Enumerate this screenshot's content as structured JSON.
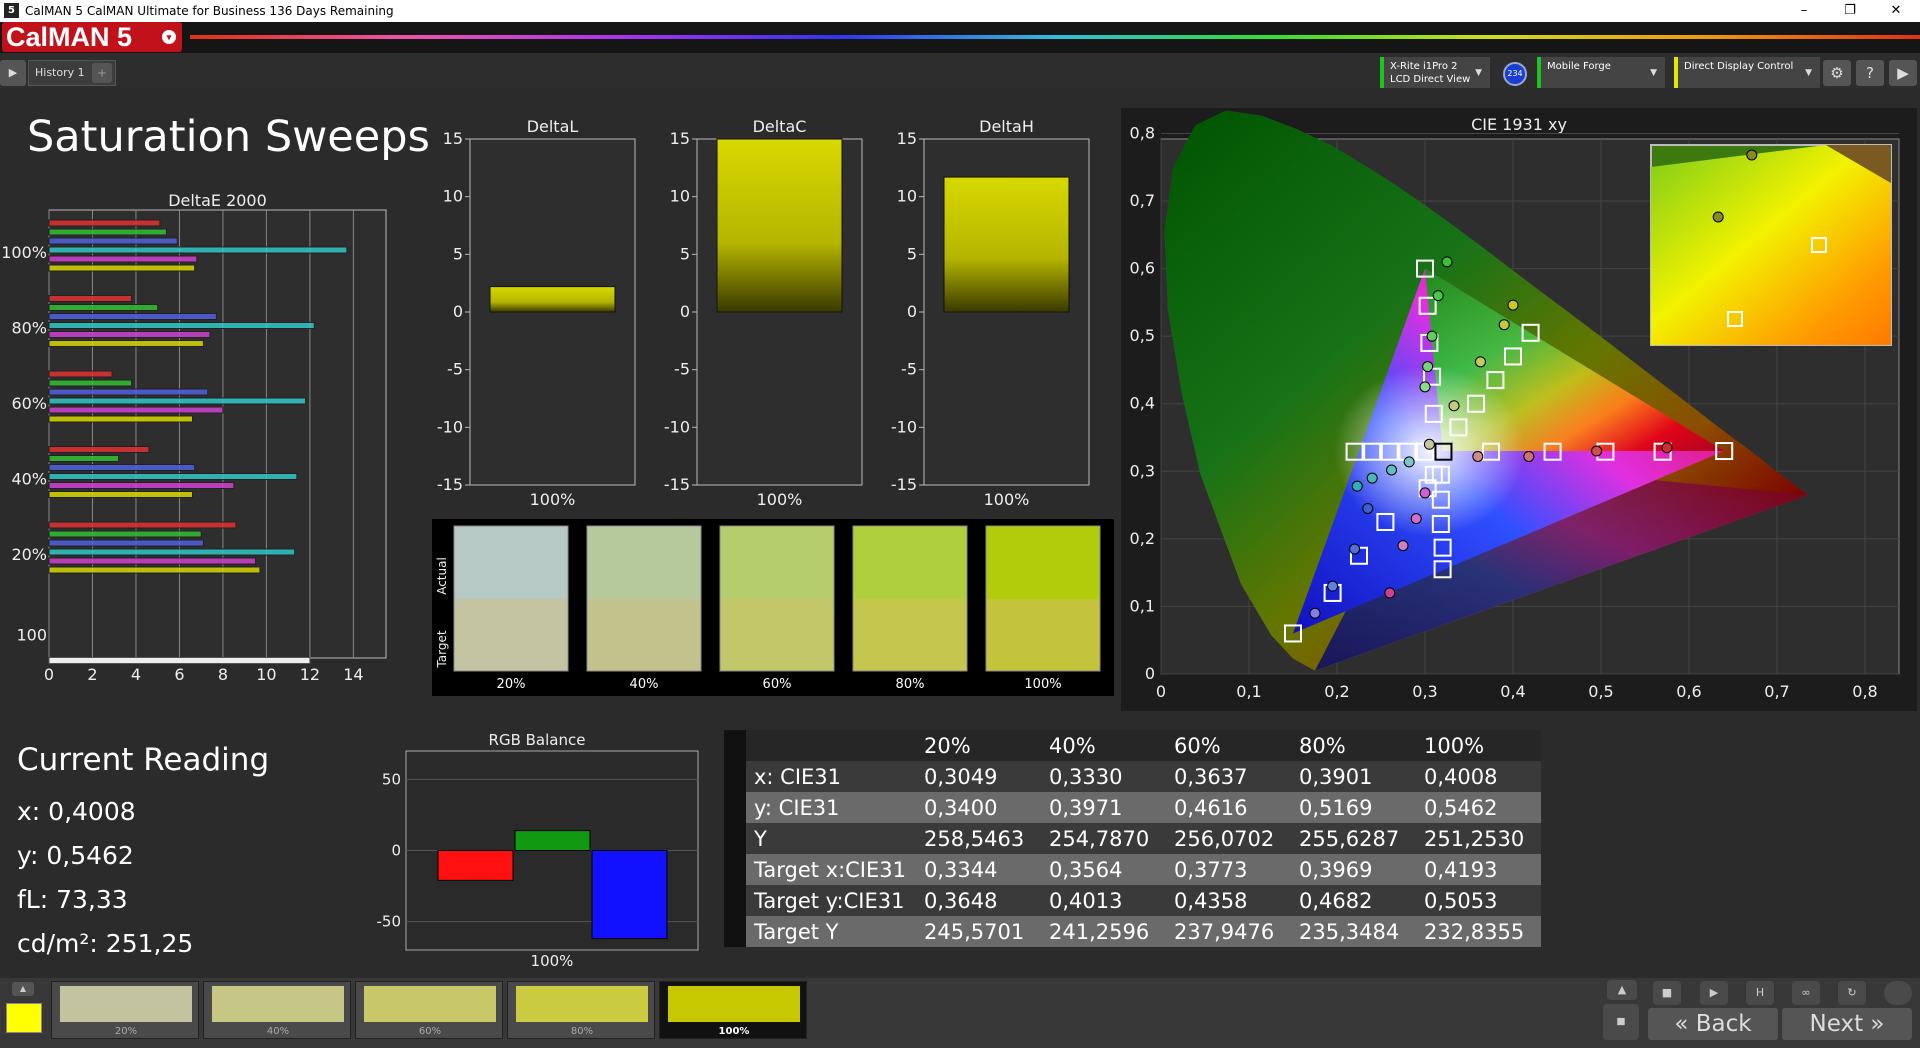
{
  "window": {
    "title": "CalMAN 5 CalMAN Ultimate for Business 136 Days Remaining",
    "minimize": "–",
    "maximize": "❐",
    "close": "✕"
  },
  "brand": {
    "name": "CalMAN 5",
    "menu": "▾"
  },
  "tabs": [
    {
      "label": "History 1"
    }
  ],
  "tab_add": "+",
  "devices": [
    {
      "line1": "X-Rite i1Pro 2",
      "line2": "LCD Direct View",
      "accent": "#1fc41f"
    },
    {
      "line1": "Mobile Forge",
      "line2": "",
      "accent": "#1fc41f"
    },
    {
      "line1": "Direct Display Control",
      "line2": "",
      "accent": "#e6e600"
    }
  ],
  "device_badge": "234",
  "toolbar_icons": [
    "gear-icon",
    "help-icon",
    "chevron-right-icon"
  ],
  "page_title": "Saturation Sweeps",
  "colors": {
    "accent": "#c8c800",
    "brand_red": "#c1121c"
  },
  "deltae": {
    "title": "DeltaE 2000",
    "ytick_labels": [
      "100%",
      "80%",
      "60%",
      "40%",
      "20%",
      "100"
    ],
    "xticks": [
      0,
      2,
      4,
      6,
      8,
      10,
      12,
      14
    ],
    "groups": [
      {
        "label": "100%",
        "values": [
          5.1,
          5.4,
          5.9,
          13.7,
          6.8,
          6.7
        ]
      },
      {
        "label": "80%",
        "values": [
          3.8,
          5.0,
          7.7,
          12.2,
          7.4,
          7.1
        ]
      },
      {
        "label": "60%",
        "values": [
          2.9,
          3.8,
          7.3,
          11.8,
          8.0,
          6.6
        ]
      },
      {
        "label": "40%",
        "values": [
          4.6,
          3.2,
          6.7,
          11.4,
          8.5,
          6.6
        ]
      },
      {
        "label": "20%",
        "values": [
          8.6,
          7.0,
          7.1,
          11.3,
          9.5,
          9.7
        ]
      },
      {
        "label": "100",
        "values": [
          12.0
        ]
      }
    ],
    "series_colors": [
      "#e03030",
      "#30c030",
      "#5060e0",
      "#30c8c8",
      "#d040d0",
      "#d8d800"
    ]
  },
  "delta_charts": [
    {
      "title": "DeltaL",
      "value": 2.2,
      "category": "100%"
    },
    {
      "title": "DeltaC",
      "value": 15.0,
      "category": "100%"
    },
    {
      "title": "DeltaH",
      "value": 11.7,
      "category": "100%"
    }
  ],
  "delta_yticks": [
    15,
    10,
    5,
    0,
    -5,
    -10,
    -15
  ],
  "swatches": {
    "actual_label": "Actual",
    "target_label": "Target",
    "items": [
      {
        "label": "20%",
        "actual": "#b7c9c4",
        "target": "#c4c4a2"
      },
      {
        "label": "40%",
        "actual": "#b6c99d",
        "target": "#c2c28c"
      },
      {
        "label": "60%",
        "actual": "#b6cd6d",
        "target": "#c4c66a"
      },
      {
        "label": "80%",
        "actual": "#b0cf3c",
        "target": "#c4c64e"
      },
      {
        "label": "100%",
        "actual": "#b0cc0a",
        "target": "#c4c43c"
      }
    ]
  },
  "cie": {
    "title": "CIE 1931 xy",
    "xticks": [
      "0",
      "0,1",
      "0,2",
      "0,3",
      "0,4",
      "0,5",
      "0,6",
      "0,7",
      "0,8"
    ],
    "yticks": [
      "0",
      "0,1",
      "0,2",
      "0,3",
      "0,4",
      "0,5",
      "0,6",
      "0,7",
      "0,8"
    ],
    "targets": [
      [
        0.3,
        0.6
      ],
      [
        0.303,
        0.545
      ],
      [
        0.305,
        0.49
      ],
      [
        0.308,
        0.44
      ],
      [
        0.31,
        0.385
      ],
      [
        0.321,
        0.329
      ],
      [
        0.375,
        0.329
      ],
      [
        0.445,
        0.329
      ],
      [
        0.505,
        0.329
      ],
      [
        0.57,
        0.329
      ],
      [
        0.64,
        0.33
      ],
      [
        0.42,
        0.505
      ],
      [
        0.4,
        0.47
      ],
      [
        0.38,
        0.435
      ],
      [
        0.358,
        0.4
      ],
      [
        0.338,
        0.365
      ],
      [
        0.22,
        0.329
      ],
      [
        0.24,
        0.329
      ],
      [
        0.26,
        0.329
      ],
      [
        0.28,
        0.329
      ],
      [
        0.3,
        0.329
      ],
      [
        0.31,
        0.295
      ],
      [
        0.303,
        0.275
      ],
      [
        0.255,
        0.225
      ],
      [
        0.225,
        0.175
      ],
      [
        0.195,
        0.12
      ],
      [
        0.15,
        0.06
      ],
      [
        0.318,
        0.295
      ],
      [
        0.318,
        0.258
      ],
      [
        0.318,
        0.222
      ],
      [
        0.32,
        0.187
      ],
      [
        0.32,
        0.155
      ]
    ],
    "measured": [
      {
        "x": 0.325,
        "y": 0.61,
        "c": "#3bbf3b"
      },
      {
        "x": 0.315,
        "y": 0.56,
        "c": "#49c849"
      },
      {
        "x": 0.308,
        "y": 0.5,
        "c": "#5cd05c"
      },
      {
        "x": 0.303,
        "y": 0.455,
        "c": "#72d672"
      },
      {
        "x": 0.3,
        "y": 0.425,
        "c": "#8adc8a"
      },
      {
        "x": 0.4,
        "y": 0.546,
        "c": "#c8c820"
      },
      {
        "x": 0.39,
        "y": 0.517,
        "c": "#c8c840"
      },
      {
        "x": 0.363,
        "y": 0.462,
        "c": "#c8c860"
      },
      {
        "x": 0.333,
        "y": 0.397,
        "c": "#c8c880"
      },
      {
        "x": 0.305,
        "y": 0.34,
        "c": "#c8c8a0"
      },
      {
        "x": 0.575,
        "y": 0.335,
        "c": "#cc3030"
      },
      {
        "x": 0.495,
        "y": 0.33,
        "c": "#cc5050"
      },
      {
        "x": 0.418,
        "y": 0.322,
        "c": "#d07070"
      },
      {
        "x": 0.36,
        "y": 0.322,
        "c": "#d08a8a"
      },
      {
        "x": 0.223,
        "y": 0.278,
        "c": "#30b0b0"
      },
      {
        "x": 0.24,
        "y": 0.29,
        "c": "#48b8b8"
      },
      {
        "x": 0.262,
        "y": 0.302,
        "c": "#60c0c0"
      },
      {
        "x": 0.282,
        "y": 0.314,
        "c": "#7ac8c8"
      },
      {
        "x": 0.235,
        "y": 0.245,
        "c": "#4060d0"
      },
      {
        "x": 0.22,
        "y": 0.185,
        "c": "#5070d8"
      },
      {
        "x": 0.195,
        "y": 0.13,
        "c": "#6080e0"
      },
      {
        "x": 0.175,
        "y": 0.09,
        "c": "#8080e0"
      },
      {
        "x": 0.3,
        "y": 0.268,
        "c": "#d060d0"
      },
      {
        "x": 0.29,
        "y": 0.23,
        "c": "#d070c8"
      },
      {
        "x": 0.275,
        "y": 0.19,
        "c": "#d080c0"
      },
      {
        "x": 0.26,
        "y": 0.12,
        "c": "#d04090"
      }
    ],
    "inset": {
      "targets": [
        [
          0.7,
          0.5
        ],
        [
          0.35,
          0.13
        ]
      ],
      "measured": [
        {
          "x": 0.42,
          "y": 0.95
        },
        {
          "x": 0.28,
          "y": 0.64
        }
      ]
    }
  },
  "current_reading": {
    "title": "Current Reading",
    "x": "x: 0,4008",
    "y": "y: 0,5462",
    "fl": "fL: 73,33",
    "cdm2": "cd/m²: 251,25"
  },
  "rgb_balance": {
    "title": "RGB Balance",
    "category": "100%",
    "yticks": [
      50,
      0,
      -50
    ],
    "values": [
      {
        "name": "R",
        "value": -21,
        "color": "#ff1111"
      },
      {
        "name": "G",
        "value": 14,
        "color": "#119911"
      },
      {
        "name": "B",
        "value": -62,
        "color": "#1111ff"
      }
    ],
    "ylim": [
      -70,
      70
    ]
  },
  "table": {
    "headers": [
      "",
      "20%",
      "40%",
      "60%",
      "80%",
      "100%"
    ],
    "rows": [
      {
        "label": "x: CIE31",
        "values": [
          "0,3049",
          "0,3330",
          "0,3637",
          "0,3901",
          "0,4008"
        ]
      },
      {
        "label": "y: CIE31",
        "values": [
          "0,3400",
          "0,3971",
          "0,4616",
          "0,5169",
          "0,5462"
        ]
      },
      {
        "label": "Y",
        "values": [
          "258,5463",
          "254,7870",
          "256,0702",
          "255,6287",
          "251,2530"
        ]
      },
      {
        "label": "Target x:CIE31",
        "values": [
          "0,3344",
          "0,3564",
          "0,3773",
          "0,3969",
          "0,4193"
        ]
      },
      {
        "label": "Target y:CIE31",
        "values": [
          "0,3648",
          "0,4013",
          "0,4358",
          "0,4682",
          "0,5053"
        ]
      },
      {
        "label": "Target Y",
        "values": [
          "245,5701",
          "241,2596",
          "237,9476",
          "235,3484",
          "232,8355"
        ]
      }
    ]
  },
  "bottom_tiles": [
    {
      "label": "20%",
      "color": "#c3c3a0"
    },
    {
      "label": "40%",
      "color": "#c6c685"
    },
    {
      "label": "60%",
      "color": "#c8c868"
    },
    {
      "label": "80%",
      "color": "#cbcb42"
    },
    {
      "label": "100%",
      "color": "#c8c800"
    }
  ],
  "current_color": "#ffff00",
  "nav": {
    "back": "Back",
    "next": "Next",
    "back_icon": "«",
    "next_icon": "»"
  }
}
